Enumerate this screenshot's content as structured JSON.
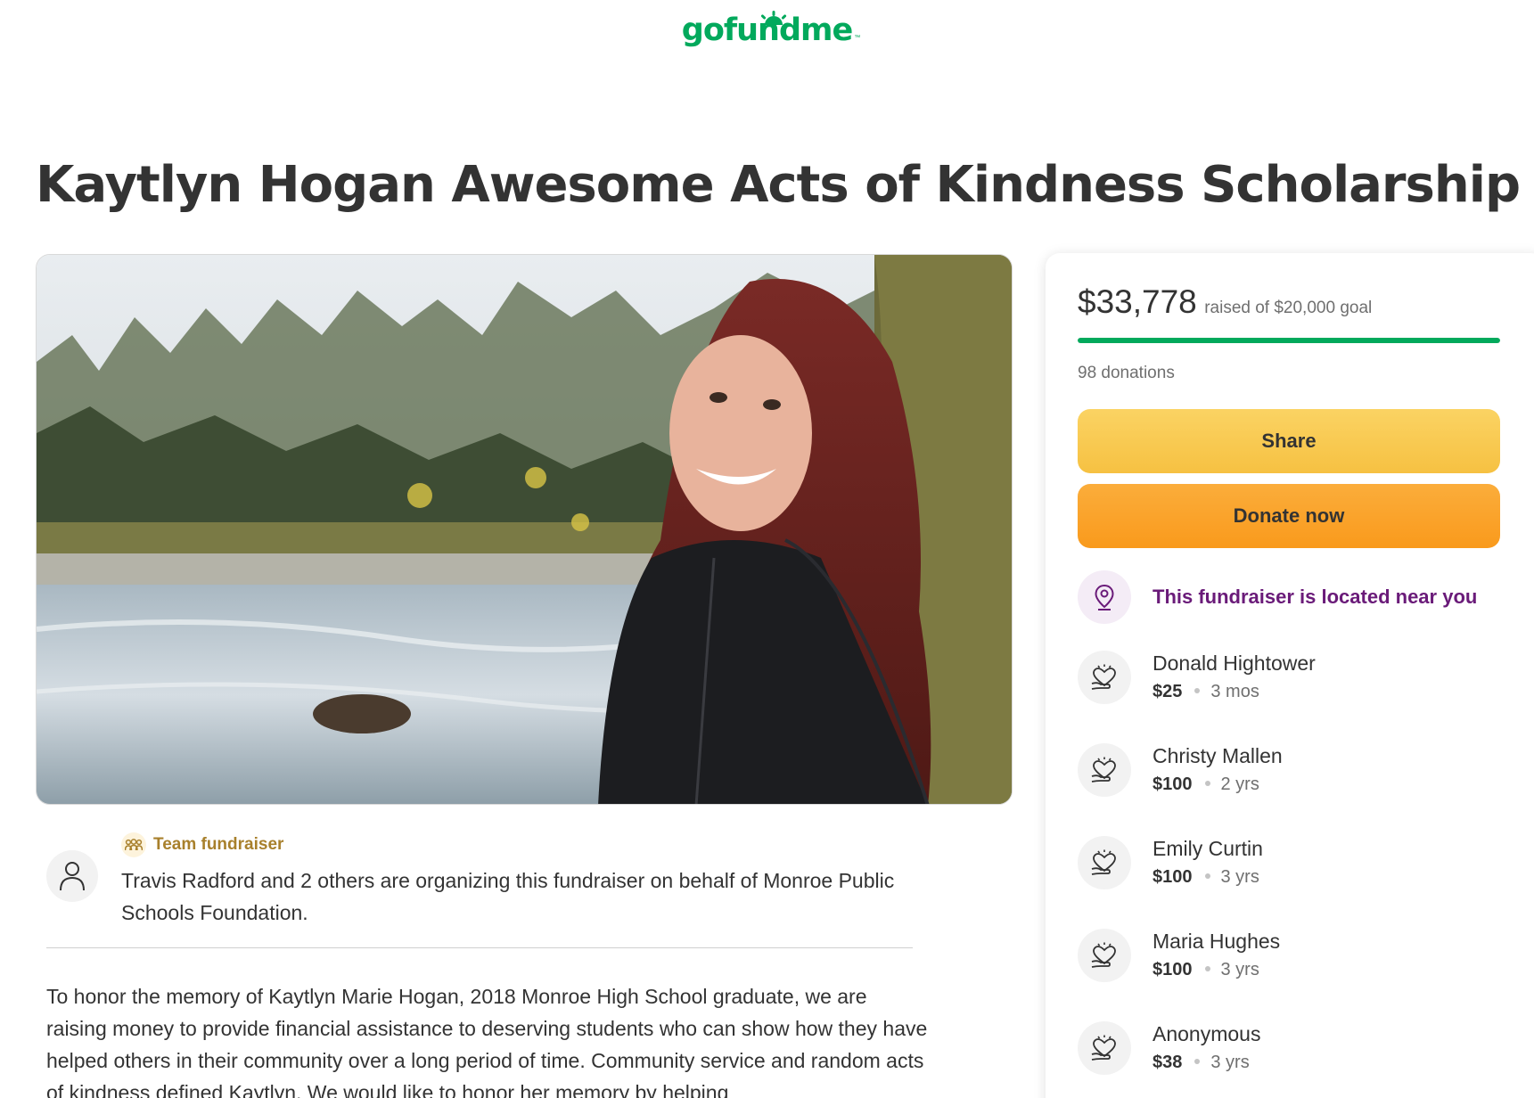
{
  "header": {
    "logo_text": "gofundme",
    "logo_tm": "™"
  },
  "campaign": {
    "title": "Kaytlyn Hogan Awesome Acts of Kindness Scholarship"
  },
  "organizer": {
    "team_label": "Team fundraiser",
    "text": "Travis Radford and 2 others are organizing this fundraiser on behalf of Monroe Public Schools Foundation."
  },
  "story": {
    "text": "To honor the memory of Kaytlyn Marie Hogan, 2018 Monroe High School graduate, we are raising money to provide financial assistance to deserving students who can show how they have helped others in their community over a long period of time. Community service and random acts of kindness defined Kaytlyn. We would like to honor her memory by helping"
  },
  "sidebar": {
    "raised_amount": "$33,778",
    "raised_goal_text": "raised of $20,000 goal",
    "progress_fraction": 1.0,
    "donations_count": "98 donations",
    "share_label": "Share",
    "donate_label": "Donate now",
    "near_text": "This fundraiser is located near you",
    "donors": [
      {
        "name": "Donald Hightower",
        "amount": "$25",
        "time": "3 mos"
      },
      {
        "name": "Christy Mallen",
        "amount": "$100",
        "time": "2 yrs"
      },
      {
        "name": "Emily Curtin",
        "amount": "$100",
        "time": "3 yrs"
      },
      {
        "name": "Maria Hughes",
        "amount": "$100",
        "time": "3 yrs"
      },
      {
        "name": "Anonymous",
        "amount": "$38",
        "time": "3 yrs"
      }
    ]
  },
  "icons": {
    "avatar": "user-icon",
    "team": "team-icon",
    "near": "location-pin-icon",
    "donor": "heart-hand-icon"
  },
  "colors": {
    "brand_green": "#02a95c",
    "share_yellow": "#f6c142",
    "donate_orange": "#f99a1c",
    "near_purple": "#6a1b79",
    "team_gold": "#a8802c"
  }
}
